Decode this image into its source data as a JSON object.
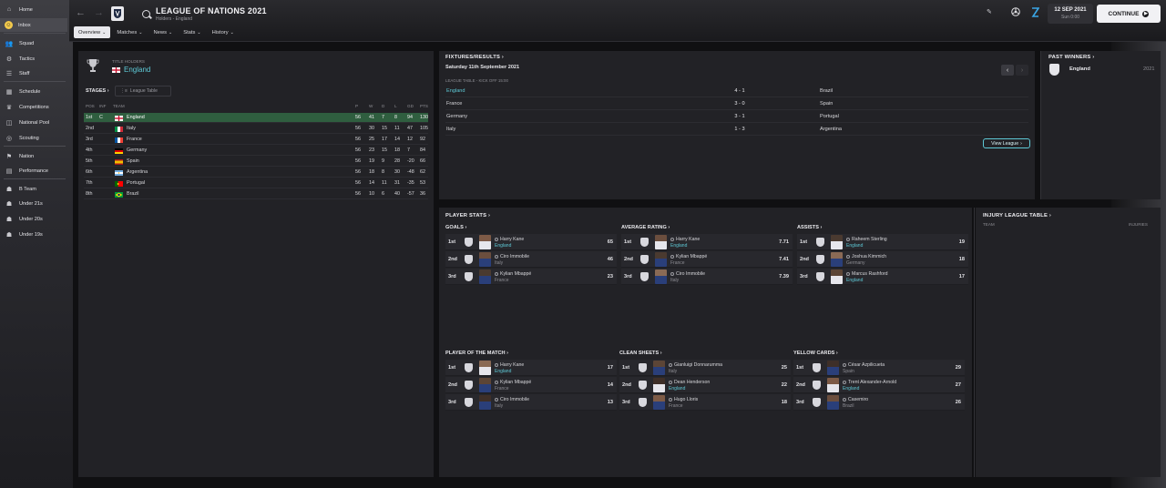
{
  "sidebar": {
    "items": [
      {
        "label": "Home",
        "icon": "home-icon",
        "glyph": "⌂"
      },
      {
        "label": "Inbox",
        "icon": "inbox-icon",
        "glyph": "☺"
      },
      {
        "label": "Squad",
        "icon": "squad-icon",
        "glyph": "👥"
      },
      {
        "label": "Tactics",
        "icon": "tactics-icon",
        "glyph": "⚙"
      },
      {
        "label": "Staff",
        "icon": "staff-icon",
        "glyph": "☰"
      },
      {
        "label": "Schedule",
        "icon": "schedule-icon",
        "glyph": "▦"
      },
      {
        "label": "Competitions",
        "icon": "competitions-icon",
        "glyph": "♛"
      },
      {
        "label": "National Pool",
        "icon": "national-pool-icon",
        "glyph": "◫"
      },
      {
        "label": "Scouting",
        "icon": "scouting-icon",
        "glyph": "◎"
      },
      {
        "label": "Nation",
        "icon": "nation-icon",
        "glyph": "⚑"
      },
      {
        "label": "Performance",
        "icon": "performance-icon",
        "glyph": "▤"
      },
      {
        "label": "B Team",
        "icon": "b-team-icon",
        "glyph": "☗"
      },
      {
        "label": "Under 21s",
        "icon": "under-21s-icon",
        "glyph": "☗"
      },
      {
        "label": "Under 20s",
        "icon": "under-20s-icon",
        "glyph": "☗"
      },
      {
        "label": "Under 19s",
        "icon": "under-19s-icon",
        "glyph": "☗"
      }
    ]
  },
  "header": {
    "title": "LEAGUE OF NATIONS 2021",
    "subtitle": "Holders - England",
    "tabs": [
      "Overview",
      "Matches",
      "News",
      "Stats",
      "History"
    ],
    "date": "12 SEP 2021",
    "day_time": "Sun 0:00",
    "continue_label": "CONTINUE"
  },
  "title_holders": {
    "label": "TITLE HOLDERS",
    "team": "England"
  },
  "stages": {
    "label": "STAGES",
    "select": "League Table"
  },
  "league_table": {
    "headers": [
      "POS",
      "INF",
      "TEAM",
      "P",
      "W",
      "D",
      "L",
      "GD",
      "PTS"
    ],
    "rows": [
      {
        "pos": "1st",
        "inf": "C",
        "team": "England",
        "p": "56",
        "w": "41",
        "d": "7",
        "l": "8",
        "gd": "94",
        "pts": "130",
        "flag": "england"
      },
      {
        "pos": "2nd",
        "inf": "",
        "team": "Italy",
        "p": "56",
        "w": "30",
        "d": "15",
        "l": "11",
        "gd": "47",
        "pts": "105",
        "flag": "italy"
      },
      {
        "pos": "3rd",
        "inf": "",
        "team": "France",
        "p": "56",
        "w": "25",
        "d": "17",
        "l": "14",
        "gd": "12",
        "pts": "92",
        "flag": "france"
      },
      {
        "pos": "4th",
        "inf": "",
        "team": "Germany",
        "p": "56",
        "w": "23",
        "d": "15",
        "l": "18",
        "gd": "7",
        "pts": "84",
        "flag": "germany"
      },
      {
        "pos": "5th",
        "inf": "",
        "team": "Spain",
        "p": "56",
        "w": "19",
        "d": "9",
        "l": "28",
        "gd": "-20",
        "pts": "66",
        "flag": "spain"
      },
      {
        "pos": "6th",
        "inf": "",
        "team": "Argentina",
        "p": "56",
        "w": "18",
        "d": "8",
        "l": "30",
        "gd": "-48",
        "pts": "62",
        "flag": "argentina"
      },
      {
        "pos": "7th",
        "inf": "",
        "team": "Portugal",
        "p": "56",
        "w": "14",
        "d": "11",
        "l": "31",
        "gd": "-35",
        "pts": "53",
        "flag": "portugal"
      },
      {
        "pos": "8th",
        "inf": "",
        "team": "Brazil",
        "p": "56",
        "w": "10",
        "d": "6",
        "l": "40",
        "gd": "-57",
        "pts": "36",
        "flag": "brazil"
      }
    ]
  },
  "fixtures": {
    "title": "FIXTURES/RESULTS",
    "date": "Saturday 11th September 2021",
    "sub": "LEAGUE TABLE - KICK OFF 15:00",
    "matches": [
      {
        "home": "England",
        "score": "4 - 1",
        "away": "Brazil",
        "home_hl": true
      },
      {
        "home": "France",
        "score": "3 - 0",
        "away": "Spain",
        "home_hl": false
      },
      {
        "home": "Germany",
        "score": "3 - 1",
        "away": "Portugal",
        "home_hl": false
      },
      {
        "home": "Italy",
        "score": "1 - 3",
        "away": "Argentina",
        "home_hl": false
      }
    ],
    "view_label": "View League"
  },
  "past_winners": {
    "title": "PAST WINNERS",
    "team": "England",
    "year": "2021"
  },
  "player_stats": {
    "title": "PLAYER STATS",
    "blocks": [
      {
        "title": "GOALS",
        "rows": [
          {
            "rank": "1st",
            "name": "Harry Kane",
            "nation": "England",
            "value": "65",
            "hl": true
          },
          {
            "rank": "2nd",
            "name": "Ciro Immobile",
            "nation": "Italy",
            "value": "46",
            "hl": false
          },
          {
            "rank": "3rd",
            "name": "Kylian Mbappé",
            "nation": "France",
            "value": "23",
            "hl": false
          }
        ]
      },
      {
        "title": "AVERAGE RATING",
        "rows": [
          {
            "rank": "1st",
            "name": "Harry Kane",
            "nation": "England",
            "value": "7.71",
            "hl": true
          },
          {
            "rank": "2nd",
            "name": "Kylian Mbappé",
            "nation": "France",
            "value": "7.41",
            "hl": false
          },
          {
            "rank": "3rd",
            "name": "Ciro Immobile",
            "nation": "Italy",
            "value": "7.39",
            "hl": false
          }
        ]
      },
      {
        "title": "ASSISTS",
        "rows": [
          {
            "rank": "1st",
            "name": "Raheem Sterling",
            "nation": "England",
            "value": "19",
            "hl": true
          },
          {
            "rank": "2nd",
            "name": "Joshua Kimmich",
            "nation": "Germany",
            "value": "18",
            "hl": false
          },
          {
            "rank": "3rd",
            "name": "Marcus Rashford",
            "nation": "England",
            "value": "17",
            "hl": true
          }
        ]
      },
      {
        "title": "PLAYER OF THE MATCH",
        "rows": [
          {
            "rank": "1st",
            "name": "Harry Kane",
            "nation": "England",
            "value": "17",
            "hl": true
          },
          {
            "rank": "2nd",
            "name": "Kylian Mbappé",
            "nation": "France",
            "value": "14",
            "hl": false
          },
          {
            "rank": "3rd",
            "name": "Ciro Immobile",
            "nation": "Italy",
            "value": "13",
            "hl": false
          }
        ]
      },
      {
        "title": "CLEAN SHEETS",
        "rows": [
          {
            "rank": "1st",
            "name": "Gianluigi Donnarumma",
            "nation": "Italy",
            "value": "25",
            "hl": false
          },
          {
            "rank": "2nd",
            "name": "Dean Henderson",
            "nation": "England",
            "value": "22",
            "hl": true
          },
          {
            "rank": "3rd",
            "name": "Hugo Lloris",
            "nation": "France",
            "value": "18",
            "hl": false
          }
        ]
      },
      {
        "title": "YELLOW CARDS",
        "rows": [
          {
            "rank": "1st",
            "name": "César Azpilicueta",
            "nation": "Spain",
            "value": "29",
            "hl": false
          },
          {
            "rank": "2nd",
            "name": "Trent Alexander-Arnold",
            "nation": "England",
            "value": "27",
            "hl": true
          },
          {
            "rank": "3rd",
            "name": "Casemiro",
            "nation": "Brazil",
            "value": "26",
            "hl": false
          }
        ]
      }
    ]
  },
  "injury_table": {
    "title": "INJURY LEAGUE TABLE",
    "col_team": "TEAM",
    "col_injuries": "INJURIES"
  },
  "colors": {
    "accent": "#5ec9d6",
    "highlight_row": "#2f5e3f",
    "panel": "#222226",
    "continue_bg": "#f1f1f4"
  }
}
